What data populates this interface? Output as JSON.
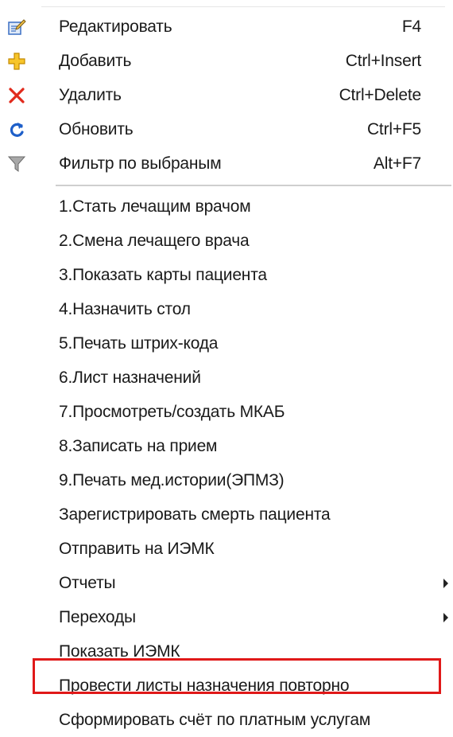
{
  "menu": {
    "top_items": [
      {
        "label": "Редактировать",
        "shortcut": "F4",
        "icon": "edit-icon"
      },
      {
        "label": "Добавить",
        "shortcut": "Ctrl+Insert",
        "icon": "add-icon"
      },
      {
        "label": "Удалить",
        "shortcut": "Ctrl+Delete",
        "icon": "delete-icon"
      },
      {
        "label": "Обновить",
        "shortcut": "Ctrl+F5",
        "icon": "refresh-icon"
      },
      {
        "label": "Фильтр по выбраным",
        "shortcut": "Alt+F7",
        "icon": "filter-icon"
      }
    ],
    "items": [
      {
        "label": "1.Стать лечащим врачом"
      },
      {
        "label": "2.Смена лечащего врача"
      },
      {
        "label": "3.Показать карты пациента"
      },
      {
        "label": "4.Назначить стол"
      },
      {
        "label": "5.Печать штрих-кода"
      },
      {
        "label": "6.Лист назначений"
      },
      {
        "label": "7.Просмотреть/создать МКАБ"
      },
      {
        "label": "8.Записать на прием"
      },
      {
        "label": "9.Печать мед.истории(ЭПМЗ)"
      },
      {
        "label": "Зарегистрировать смерть пациента"
      },
      {
        "label": "Отправить на ИЭМК"
      },
      {
        "label": "Отчеты",
        "submenu": true
      },
      {
        "label": "Переходы",
        "submenu": true
      },
      {
        "label": "Показать ИЭМК"
      },
      {
        "label": "Провести листы назначения повторно",
        "highlighted": true
      },
      {
        "label": "Сформировать счёт по платным услугам"
      }
    ]
  },
  "colors": {
    "highlight_border": "#e01919",
    "edit_icon": "#3a6fc4",
    "add_icon": "#f0b400",
    "delete_icon": "#e12a1c",
    "refresh_icon": "#1e5fc9",
    "filter_icon": "#8a8a8a"
  }
}
